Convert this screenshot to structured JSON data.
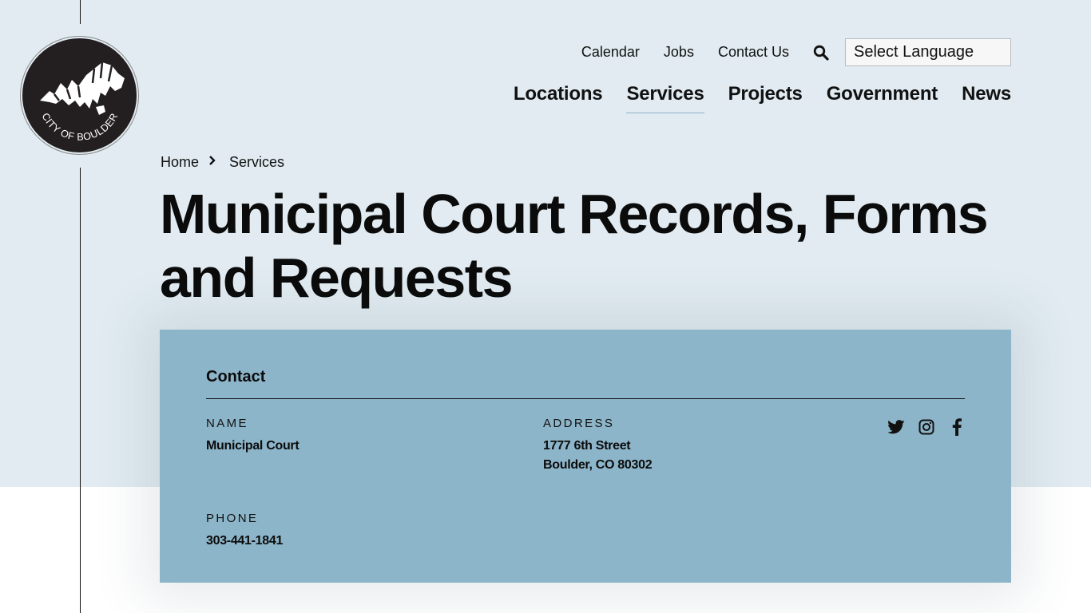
{
  "site": {
    "logo_text": "CITY OF BOULDER"
  },
  "utility_nav": {
    "links": [
      "Calendar",
      "Jobs",
      "Contact Us"
    ],
    "search_icon": "search-icon",
    "language_select": "Select Language"
  },
  "main_nav": {
    "items": [
      {
        "label": "Locations",
        "active": false
      },
      {
        "label": "Services",
        "active": true
      },
      {
        "label": "Projects",
        "active": false
      },
      {
        "label": "Government",
        "active": false
      },
      {
        "label": "News",
        "active": false
      }
    ]
  },
  "breadcrumb": {
    "items": [
      "Home",
      "Services"
    ],
    "separator_icon": "chevron-right-icon"
  },
  "page": {
    "title": "Municipal Court Records, Forms and Requests"
  },
  "contact": {
    "heading": "Contact",
    "name_label": "NAME",
    "name_value": "Municipal Court",
    "address_label": "ADDRESS",
    "address_line1": "1777 6th Street",
    "address_line2": "Boulder, CO 80302",
    "phone_label": "PHONE",
    "phone_value": "303-441-1841",
    "social": [
      "twitter-icon",
      "instagram-icon",
      "facebook-icon"
    ]
  },
  "colors": {
    "hero_bg": "#e1ebf1",
    "card_bg": "#8db5c9",
    "text": "#0b0b0b",
    "active_underline": "#8fb5c9"
  }
}
